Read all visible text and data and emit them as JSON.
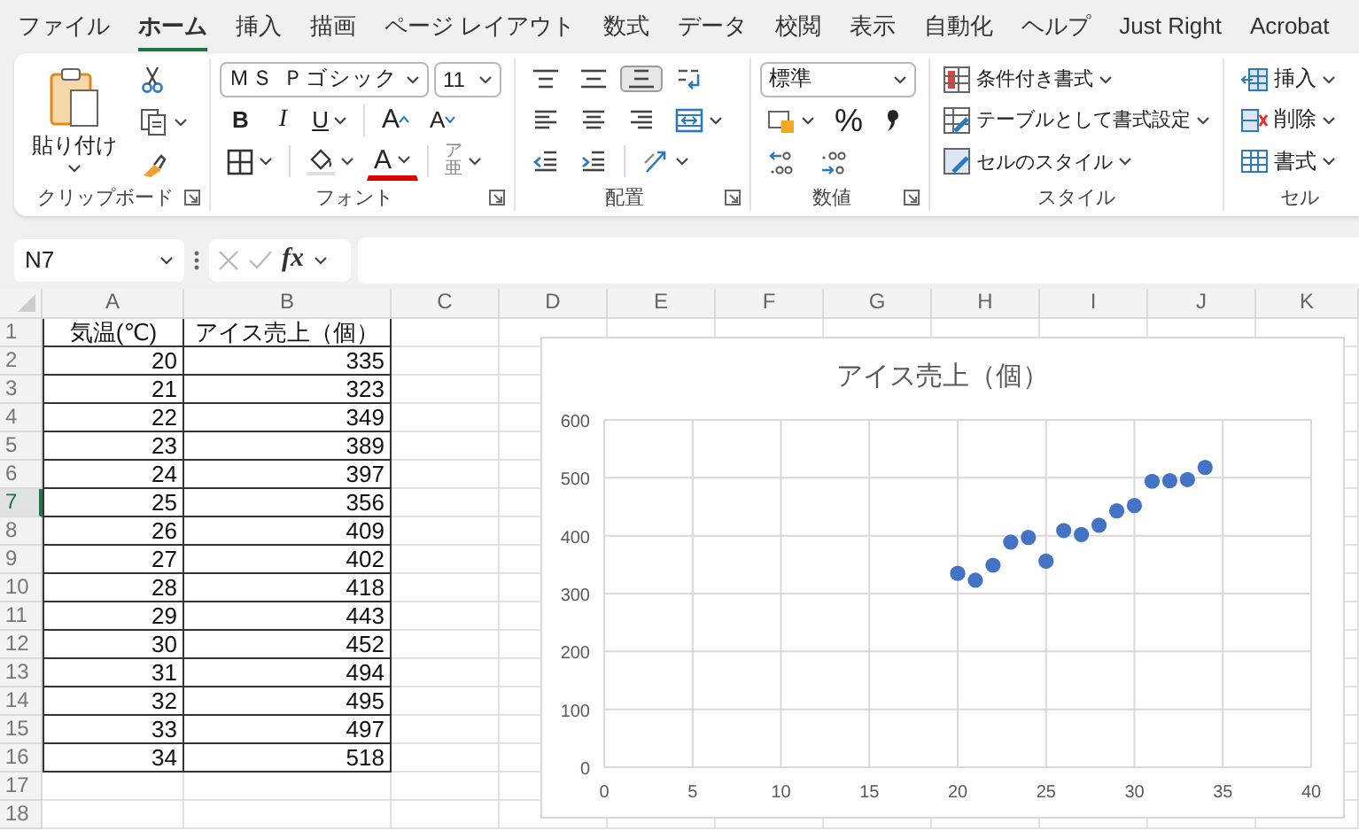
{
  "menu_tabs": [
    {
      "label": "ファイル",
      "selected": false
    },
    {
      "label": "ホーム",
      "selected": true
    },
    {
      "label": "挿入",
      "selected": false
    },
    {
      "label": "描画",
      "selected": false
    },
    {
      "label": "ページ レイアウト",
      "selected": false
    },
    {
      "label": "数式",
      "selected": false
    },
    {
      "label": "データ",
      "selected": false
    },
    {
      "label": "校閲",
      "selected": false
    },
    {
      "label": "表示",
      "selected": false
    },
    {
      "label": "自動化",
      "selected": false
    },
    {
      "label": "ヘルプ",
      "selected": false
    },
    {
      "label": "Just Right",
      "selected": false
    },
    {
      "label": "Acrobat",
      "selected": false
    }
  ],
  "ribbon": {
    "groups": [
      {
        "kind": "clipboard",
        "label": "クリップボード",
        "paste": "貼り付け"
      },
      {
        "kind": "font",
        "label": "フォント",
        "font_name": "ＭＳ Ｐゴシック",
        "font_size": "11",
        "bold": "B",
        "italic": "I",
        "underline": "U",
        "grow": "A",
        "shrink": "A",
        "font_color": "A",
        "phonetic": "ア亜"
      },
      {
        "kind": "alignment",
        "label": "配置",
        "vertical": [
          {
            "selected": false
          },
          {
            "selected": false
          },
          {
            "selected": true
          }
        ]
      },
      {
        "kind": "number",
        "label": "数値",
        "format": "標準",
        "percent": "%"
      },
      {
        "kind": "styles",
        "label": "スタイル",
        "items": [
          "条件付き書式",
          "テーブルとして書式設定",
          "セルのスタイル"
        ]
      },
      {
        "kind": "cells",
        "label": "セル",
        "items": [
          "挿入",
          "削除",
          "書式"
        ]
      }
    ]
  },
  "formula_bar": {
    "name_box": "N7",
    "function_label": "fx"
  },
  "sheet": {
    "columns": [
      "A",
      "B",
      "C",
      "D",
      "E",
      "F",
      "G",
      "H",
      "I",
      "J",
      "K"
    ],
    "rows": [
      {
        "label": "1",
        "selected": false,
        "kind": "header",
        "cells": [
          "気温(℃)",
          "アイス売上（個）"
        ]
      },
      {
        "label": "2",
        "selected": false,
        "kind": "data",
        "cells": [
          "20",
          "335"
        ]
      },
      {
        "label": "3",
        "selected": false,
        "kind": "data",
        "cells": [
          "21",
          "323"
        ]
      },
      {
        "label": "4",
        "selected": false,
        "kind": "data",
        "cells": [
          "22",
          "349"
        ]
      },
      {
        "label": "5",
        "selected": false,
        "kind": "data",
        "cells": [
          "23",
          "389"
        ]
      },
      {
        "label": "6",
        "selected": false,
        "kind": "data",
        "cells": [
          "24",
          "397"
        ]
      },
      {
        "label": "7",
        "selected": true,
        "kind": "data",
        "cells": [
          "25",
          "356"
        ]
      },
      {
        "label": "8",
        "selected": false,
        "kind": "data",
        "cells": [
          "26",
          "409"
        ]
      },
      {
        "label": "9",
        "selected": false,
        "kind": "data",
        "cells": [
          "27",
          "402"
        ]
      },
      {
        "label": "10",
        "selected": false,
        "kind": "data",
        "cells": [
          "28",
          "418"
        ]
      },
      {
        "label": "11",
        "selected": false,
        "kind": "data",
        "cells": [
          "29",
          "443"
        ]
      },
      {
        "label": "12",
        "selected": false,
        "kind": "data",
        "cells": [
          "30",
          "452"
        ]
      },
      {
        "label": "13",
        "selected": false,
        "kind": "data",
        "cells": [
          "31",
          "494"
        ]
      },
      {
        "label": "14",
        "selected": false,
        "kind": "data",
        "cells": [
          "32",
          "495"
        ]
      },
      {
        "label": "15",
        "selected": false,
        "kind": "data",
        "cells": [
          "33",
          "497"
        ]
      },
      {
        "label": "16",
        "selected": false,
        "kind": "data",
        "cells": [
          "34",
          "518"
        ]
      },
      {
        "label": "17",
        "selected": false
      },
      {
        "label": "18",
        "selected": false
      }
    ],
    "chart": {
      "chart_data": {
        "type": "scatter",
        "title": "アイス売上（個）",
        "x": [
          20,
          21,
          22,
          23,
          24,
          25,
          26,
          27,
          28,
          29,
          30,
          31,
          32,
          33,
          34
        ],
        "grid": true,
        "series": [
          {
            "color": "#4472c4",
            "values": [
              335,
              323,
              349,
              389,
              397,
              356,
              409,
              402,
              418,
              443,
              452,
              494,
              495,
              497,
              518
            ]
          }
        ],
        "xlim": [
          0,
          40
        ],
        "ylim": [
          0,
          600
        ],
        "xticks": [
          0,
          5,
          10,
          15,
          20,
          25,
          30,
          35,
          40
        ],
        "yticks": [
          0,
          100,
          200,
          300,
          400,
          500,
          600
        ]
      }
    }
  }
}
